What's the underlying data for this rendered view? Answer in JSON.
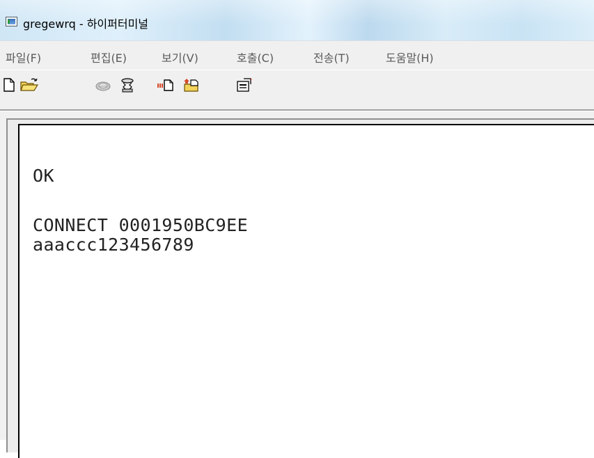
{
  "window": {
    "title": "gregewrq - 하이퍼터미널",
    "icon": "terminal-app-icon"
  },
  "menu": {
    "items": [
      {
        "id": "file",
        "label": "파일(F)"
      },
      {
        "id": "edit",
        "label": "편집(E)"
      },
      {
        "id": "view",
        "label": "보기(V)"
      },
      {
        "id": "call",
        "label": "호출(C)"
      },
      {
        "id": "transfer",
        "label": "전송(T)"
      },
      {
        "id": "help",
        "label": "도움말(H)"
      }
    ]
  },
  "toolbar": {
    "buttons": [
      {
        "id": "new",
        "icon": "new-document-icon"
      },
      {
        "id": "open",
        "icon": "open-folder-icon"
      },
      {
        "id": "dial",
        "icon": "phone-dial-icon"
      },
      {
        "id": "disconnect",
        "icon": "phone-disconnect-icon"
      },
      {
        "id": "send",
        "icon": "send-file-icon"
      },
      {
        "id": "receive",
        "icon": "receive-file-icon"
      },
      {
        "id": "properties",
        "icon": "properties-icon"
      }
    ]
  },
  "terminal": {
    "lines": [
      "OK",
      "CONNECT 0001950BC9EE",
      "aaaccc123456789"
    ]
  }
}
